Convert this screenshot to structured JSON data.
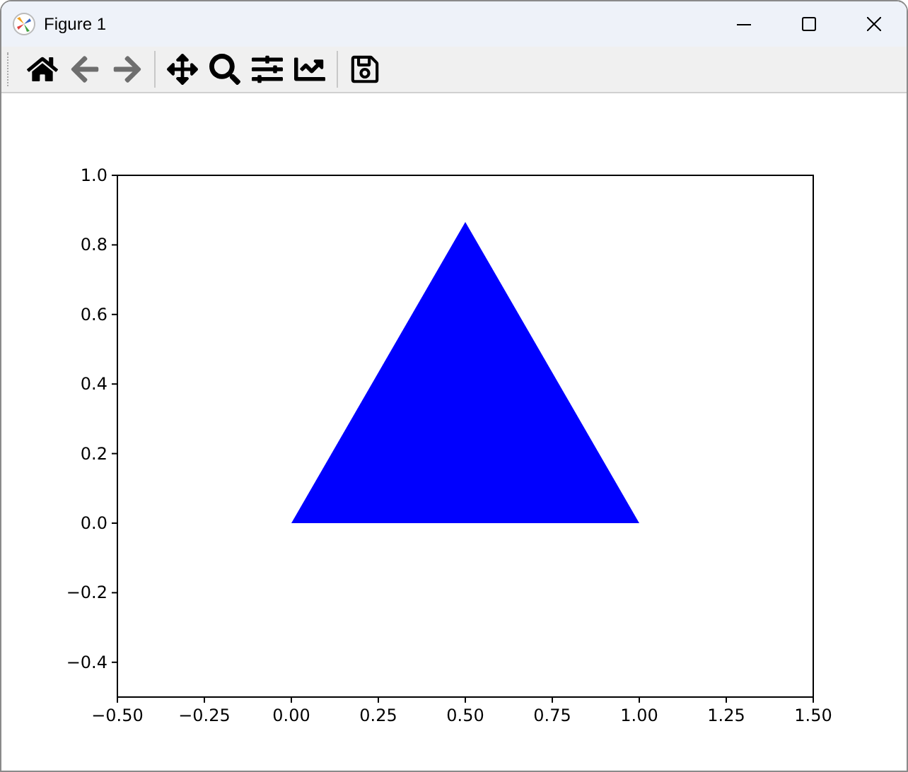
{
  "window": {
    "title": "Figure 1"
  },
  "toolbar": [
    {
      "kind": "home",
      "disabled": false
    },
    {
      "kind": "back",
      "disabled": true
    },
    {
      "kind": "forward",
      "disabled": true
    },
    {
      "kind": "separator"
    },
    {
      "kind": "pan",
      "disabled": false
    },
    {
      "kind": "zoom",
      "disabled": false
    },
    {
      "kind": "subplots",
      "disabled": false
    },
    {
      "kind": "axes",
      "disabled": false
    },
    {
      "kind": "separator"
    },
    {
      "kind": "save",
      "disabled": false
    }
  ],
  "figure": {
    "chart_data": {
      "type": "area",
      "x": [
        0,
        0.5,
        1
      ],
      "series": [
        {
          "color": "#0000ff",
          "values": [
            0,
            0.866,
            0
          ]
        }
      ],
      "xlim": [
        -0.5,
        1.5
      ],
      "ylim": [
        -0.5,
        1.0
      ],
      "xticks": [
        {
          "value": -0.5,
          "label": "−0.50"
        },
        {
          "value": -0.25,
          "label": "−0.25"
        },
        {
          "value": 0,
          "label": "0.00"
        },
        {
          "value": 0.25,
          "label": "0.25"
        },
        {
          "value": 0.5,
          "label": "0.50"
        },
        {
          "value": 0.75,
          "label": "0.75"
        },
        {
          "value": 1,
          "label": "1.00"
        },
        {
          "value": 1.25,
          "label": "1.25"
        },
        {
          "value": 1.5,
          "label": "1.50"
        }
      ],
      "yticks": [
        {
          "value": -0.4,
          "label": "−0.4"
        },
        {
          "value": -0.2,
          "label": "−0.2"
        },
        {
          "value": 0,
          "label": "0.0"
        },
        {
          "value": 0.2,
          "label": "0.2"
        },
        {
          "value": 0.4,
          "label": "0.4"
        },
        {
          "value": 0.6,
          "label": "0.6"
        },
        {
          "value": 0.8,
          "label": "0.8"
        },
        {
          "value": 1,
          "label": "1.0"
        }
      ]
    }
  }
}
